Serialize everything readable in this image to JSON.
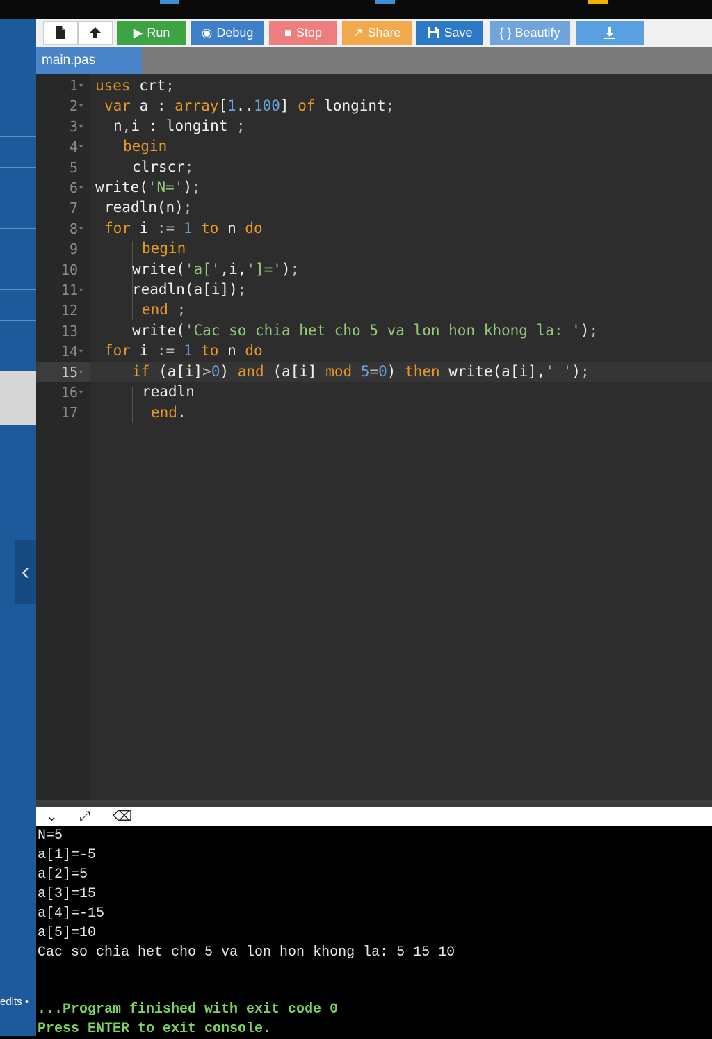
{
  "toolbar": {
    "new_icon": "file-icon",
    "upload_icon": "upload-icon",
    "buttons": [
      {
        "label": "Run",
        "color": "#3ea443"
      },
      {
        "label": "Debug",
        "color": "#3d7fc9"
      },
      {
        "label": "Stop",
        "color": "#ee7d7d"
      },
      {
        "label": "Share",
        "color": "#f2a94b"
      },
      {
        "label": "Save",
        "color": "#2c79c6"
      },
      {
        "label": "{ } Beautify",
        "color": "#6fa4dc"
      }
    ],
    "download_icon": "download-icon"
  },
  "file_tab": "main.pas",
  "editor": {
    "line_numbers": [
      "1",
      "2",
      "3",
      "4",
      "5",
      "6",
      "7",
      "8",
      "9",
      "10",
      "11",
      "12",
      "13",
      "14",
      "15",
      "16",
      "17"
    ]
  },
  "console": {
    "lines": [
      "N=5",
      "a[1]=-5",
      "a[2]=5",
      "a[3]=15",
      "a[4]=-15",
      "a[5]=10",
      "Cac so chia het cho 5 va lon hon khong la: 5 15 10"
    ],
    "finished": "...Program finished with exit code 0",
    "press_enter": "Press ENTER to exit console."
  },
  "sidebar": {
    "edits_label": "edits •"
  },
  "colors": {
    "editor_bg": "#2d2d2d",
    "keyword": "#e7962a",
    "number": "#6b9fd6",
    "string": "#95c97a"
  }
}
